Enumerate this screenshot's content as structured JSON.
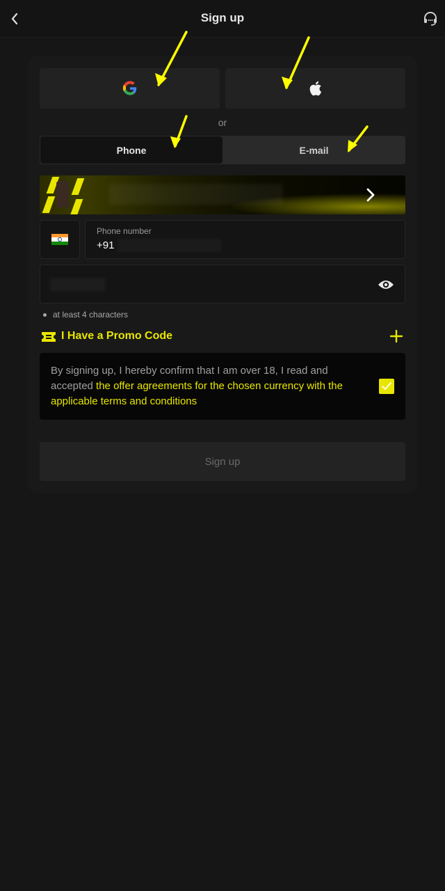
{
  "header": {
    "title": "Sign up",
    "back_icon": "chevron-left-icon",
    "support_icon": "headset-icon"
  },
  "social": {
    "google_icon": "google-icon",
    "apple_icon": "apple-icon",
    "divider_text": "or"
  },
  "tabs": [
    {
      "label": "Phone",
      "active": true
    },
    {
      "label": "E-mail",
      "active": false
    }
  ],
  "banner": {
    "chevron_icon": "chevron-right-icon"
  },
  "phone": {
    "country_flag": "india-flag-icon",
    "label": "Phone number",
    "value": "+91"
  },
  "password": {
    "eye_icon": "eye-icon",
    "hint": "at least 4 characters"
  },
  "promo": {
    "label": "I Have a Promo Code",
    "ticket_icon": "ticket-icon",
    "plus_icon": "plus-icon"
  },
  "terms": {
    "prefix": "By signing up, I hereby confirm that I am over 18, I read and accepted ",
    "link": "the offer agreements for the chosen currency with the applicable terms and conditions",
    "checked": true
  },
  "submit": {
    "label": "Sign up"
  },
  "colors": {
    "accent": "#e8e600",
    "background": "#161616",
    "annotation_arrow": "#ffff00"
  }
}
